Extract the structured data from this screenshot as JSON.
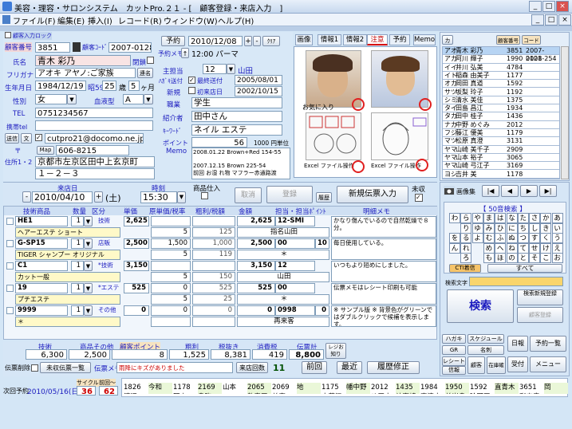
{
  "window": {
    "title": "美容・理容・サロンシステム　カットPro.２１ - [　顧客登録・来店入力　]",
    "controls": [
      "_",
      "□",
      "×"
    ],
    "inner_controls": [
      "_",
      "□",
      "×"
    ]
  },
  "menu": [
    "ファイル(F)",
    "編集(E)",
    "挿入(I)",
    "レコード(R)",
    "ウィンドウ(W)",
    "ヘルプ(H)"
  ],
  "customer": {
    "checkbox_label": "顧客入力ロック",
    "no_label": "顧客番号",
    "no": "3851",
    "code_label": "顧客ｺｰﾄﾞ",
    "code": "2007-0128",
    "name_label": "氏名",
    "name": "青木 彩乃",
    "closed_label": "閉鎖",
    "kana_label": "フリガナ",
    "kana": "アオキ アヤノ:ご家族",
    "link_btn": "連名",
    "birth_label": "生年月日",
    "birth": "1984/12/19",
    "era": "昭59",
    "age": "25",
    "age_unit": "歳",
    "months": "5",
    "month_unit": "ヶ月",
    "sex_label": "性別",
    "sex": "女",
    "blood_label": "血液型",
    "blood": "A",
    "tel_label": "TEL",
    "tel": "0751234567",
    "mobile_label": "携帯tel",
    "mail_btn1": "送信",
    "mail_btn2": "文",
    "mail": "cutpro21@docomo.ne.jp",
    "zip_label": "〒",
    "map_btn": "Map",
    "zip": "606-8215",
    "addr_label": "住所1・2",
    "addr1": "京都市左京区田中上玄京町",
    "addr2": "１－２－３"
  },
  "visit_info": {
    "reserve_btn": "予約",
    "reserve_date": "2010/12/08",
    "plus": "+",
    "minus": "-",
    "clear": "ｸﾘｱ",
    "memo_label": "予約メモ",
    "memo": "12:00 パーマ",
    "staff_label": "主担当",
    "staff_no": "12",
    "staff_name": "山田",
    "prev_label": "ﾊｶﾞｷ送付",
    "prev_chk": "最終送付",
    "prev_date": "2005/08/01",
    "new_label": "新規",
    "first_chk": "初来店日",
    "first_date": "2002/10/15",
    "job_label": "職業",
    "job": "学生",
    "intro_label": "紹介者",
    "intro": "田中さん",
    "keyword_label": "ｷｰﾜｰﾄﾞ",
    "keyword": "ネイル エステ",
    "point_label": "ポイント",
    "point": "56",
    "point_unit": "1000 円単位",
    "memo2_label": "Memo",
    "memo2": [
      "2008.01.22 Brown+Red 154-55",
      "",
      "2007.12.15 Brown 225-54",
      "前回 お湿 れ物 マフラー赤通路渡"
    ]
  },
  "tabs": [
    "画像",
    "情報1",
    "情報2",
    "注意",
    "予約",
    "Memo"
  ],
  "photos": {
    "fav_label": "お気に入り",
    "excel1": "Excel ファイル操作",
    "excel2": "Excel ファイル操作"
  },
  "customer_list": {
    "btn_search": "カ",
    "btn_no": "顧客番号",
    "btn_code": "コード",
    "rows": [
      [
        "アオ",
        "青木 彩乃",
        "3851",
        "2007-0128"
      ],
      [
        "アカ",
        "阿川 輝子",
        "1990",
        "2001-254"
      ],
      [
        "イイ",
        "井川 弘美",
        "4784",
        ""
      ],
      [
        "イト",
        "稲森 由美子",
        "1177",
        ""
      ],
      [
        "オカ",
        "岡田 真道",
        "1592",
        ""
      ],
      [
        "サツ",
        "坂梨 玲子",
        "1192",
        ""
      ],
      [
        "シミ",
        "清水 美佳",
        "1375",
        ""
      ],
      [
        "タイ",
        "田島 昌江",
        "1934",
        ""
      ],
      [
        "タカ",
        "田中 桂子",
        "1436",
        ""
      ],
      [
        "ナカ",
        "中野 めぐみ",
        "2012",
        ""
      ],
      [
        "フジ",
        "藤江 優美",
        "1179",
        ""
      ],
      [
        "マツ",
        "松原 真澄",
        "3131",
        ""
      ],
      [
        "ヤマ",
        "山崎 美千子",
        "2909",
        ""
      ],
      [
        "ヤマ",
        "山本 裕子",
        "3065",
        ""
      ],
      [
        "ヤマ",
        "山崎 弓江子",
        "3169",
        ""
      ],
      [
        "ヨシ",
        "吉井 美",
        "1178",
        ""
      ]
    ]
  },
  "visit": {
    "date_label": "来店日",
    "date": "2010/04/10",
    "dow": "(土)",
    "time_label": "時刻",
    "time": "15:30",
    "item_label": "商品仕入",
    "cancel_btn": "取消",
    "register_btn": "登録",
    "history_btn": "履歴",
    "new_slip_btn": "新規伝票入力",
    "unchecked_label": "未収"
  },
  "grid": {
    "headers": [
      "技術商品",
      "数量",
      "区分",
      "単価",
      "原単価/税率",
      "粗利/税額",
      "金額",
      "担当・担当ﾎﾟｲﾝﾄ",
      "明細メモ"
    ],
    "rows": [
      {
        "code": "HE1",
        "qty": "1",
        "type": "技術",
        "price": "2,625",
        "cost": "",
        "profit": "",
        "amount": "2,625",
        "staff": "12-SMI",
        "memo": "かなり傷んでいるので自然乾燥で８分。",
        "sub_name": "ヘアーエステ ショート",
        "sub_cost": "5",
        "sub_profit": "125",
        "sub_staff": "指名山田",
        "sub_memo": "毛先はトリートメントコーティング"
      },
      {
        "code": "G-SP15",
        "qty": "1",
        "type": "店販",
        "price": "2,500",
        "cost": "1,500",
        "profit": "1,000",
        "amount": "2,500",
        "staff": "00",
        "staff_pt": "10",
        "memo": "毎日使用している。",
        "sub_name": "TIGER シャンプー オリジナル",
        "sub_cost": "5",
        "sub_profit": "119",
        "sub_staff": "＊",
        "sub_memo": "大きいサイズが欲しい。"
      },
      {
        "code": "C1",
        "qty": "1",
        "type": "*技術",
        "price": "3,150",
        "cost": "",
        "profit": "",
        "amount": "3,150",
        "staff": "12",
        "memo": "いつもより短めにしました。",
        "sub_name": "カット一般",
        "sub_cost": "5",
        "sub_profit": "150",
        "sub_staff": "山田",
        "sub_memo": ""
      },
      {
        "code": "19",
        "qty": "1",
        "type": "*エステ",
        "price": "525",
        "cost": "0",
        "profit": "525",
        "amount": "525",
        "staff": "00",
        "memo": "伝票メモはレシート印刷も可能",
        "sub_name": "プチエステ",
        "sub_cost": "5",
        "sub_profit": "25",
        "sub_staff": "＊",
        "sub_memo": ""
      },
      {
        "code": "9999",
        "qty": "1",
        "type": "その他",
        "price": "0",
        "cost": "0",
        "profit": "0",
        "amount": "0",
        "staff": "0998",
        "staff_pt": "0",
        "memo": "※ サンプル版 ※ 背景色がグリーンではダブルクリックで候補を表示します。",
        "sub_name": "＊",
        "sub_cost": "",
        "sub_profit": "",
        "sub_staff": "再来客",
        "sub_memo": ""
      }
    ]
  },
  "totals": {
    "labels": [
      "技術",
      "商品その他",
      "顧客ポイント",
      "粗利",
      "税抜き",
      "消費税",
      "伝票計",
      "レジお知り"
    ],
    "values": [
      "6,300",
      "2,500",
      "8",
      "1,525",
      "8,381",
      "419",
      "8,800"
    ]
  },
  "bottom": {
    "slip_delete": "伝票削除",
    "unpaid_btn": "未収伝票一覧",
    "slip_memo_label": "伝票メモ",
    "slip_memo": "雨降にキズがありました",
    "count_btn": "来店回数",
    "count": "11",
    "prev_btn": "前回",
    "latest_btn": "最近",
    "history_fix": "履歴修正",
    "next_reserve_label": "次回予約",
    "next_reserve": "2010/05/16(日)",
    "cycle_label": "サイクル",
    "cycle": "36",
    "prev_label": "前回～",
    "prev_val": "62"
  },
  "right_panel": {
    "image_btn": "画像集",
    "nav": [
      "|◀",
      "◀",
      "▶",
      "▶|"
    ],
    "kana_title": "【 50音検索 】",
    "kana": [
      [
        "わ",
        "ら",
        "や",
        "ま",
        "は",
        "な",
        "た",
        "さ",
        "か",
        "あ"
      ],
      [
        "",
        "り",
        "ゆ",
        "み",
        "ひ",
        "に",
        "ち",
        "し",
        "き",
        "い"
      ],
      [
        "を",
        "る",
        "よ",
        "む",
        "ふ",
        "ぬ",
        "つ",
        "す",
        "く",
        "う"
      ],
      [
        "ん",
        "れ",
        "",
        "め",
        "へ",
        "ね",
        "て",
        "せ",
        "け",
        "え"
      ],
      [
        "",
        "ろ",
        "",
        "も",
        "ほ",
        "の",
        "と",
        "そ",
        "こ",
        "お"
      ]
    ],
    "cti_btn": "CTI着信",
    "all_btn": "すべて",
    "search_key_label": "検索文字",
    "search_btn": "検索",
    "new_reg_btn": "検索新規登録",
    "cust_reg_btn": "顧客登録",
    "btns": [
      "ハガキ",
      "スケジュール",
      "日報",
      "予約一覧",
      "GR",
      "名刺",
      "レシート",
      "顧客",
      "信報",
      "在庫確認",
      "受付",
      "メニュー"
    ]
  },
  "footer_names": [
    {
      "no": "1",
      "name": "1826 渡辺"
    },
    {
      "no": "2",
      "name": "今和"
    },
    {
      "no": "3",
      "name": "1178 岡山"
    },
    {
      "no": "4",
      "name": "2169 島弥"
    },
    {
      "no": "5",
      "name": "山本"
    },
    {
      "no": "6",
      "name": "2065 数森田"
    },
    {
      "no": "7",
      "name": "2069 美宮"
    },
    {
      "no": "8",
      "name": "地"
    },
    {
      "no": "9",
      "name": "1175 太藤江"
    },
    {
      "no": "10",
      "name": "幡中野"
    },
    {
      "no": "11",
      "name": "2012 め田中"
    },
    {
      "no": "12",
      "name": "1435 祐高崎"
    },
    {
      "no": "13",
      "name": "1984 恵清水"
    },
    {
      "no": "14",
      "name": "1950 美岩島"
    },
    {
      "no": "15",
      "name": "1592 玲岡田"
    },
    {
      "no": "16",
      "name": "直青木"
    },
    {
      "no": "17",
      "name": "3651 彩吉青山"
    },
    {
      "no": "18",
      "name": "岡"
    }
  ]
}
